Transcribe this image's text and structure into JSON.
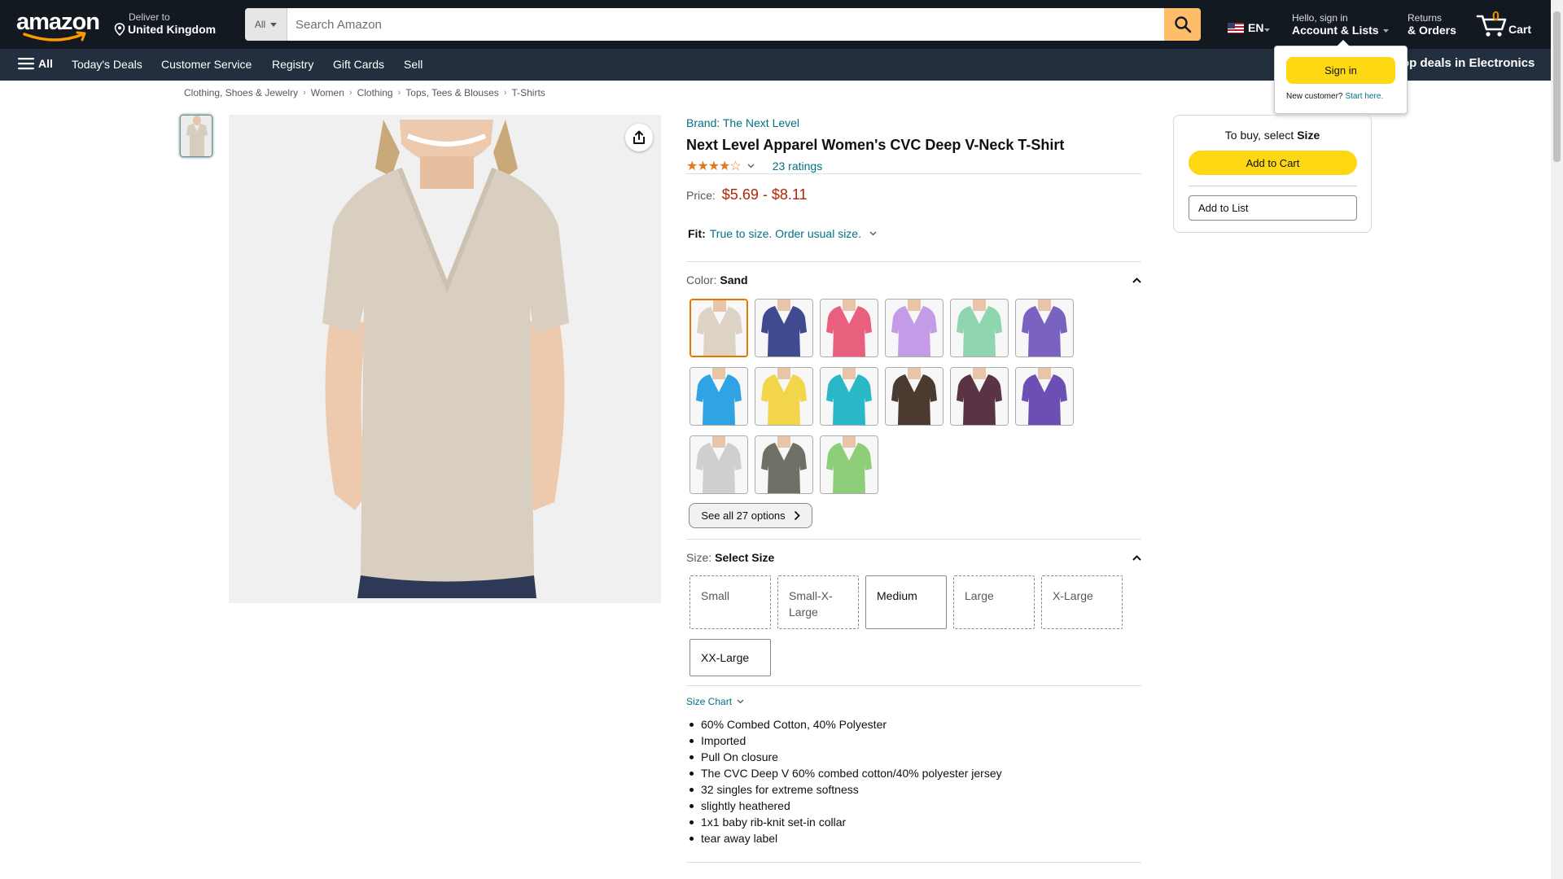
{
  "header": {
    "logo_text": "amazon",
    "deliver_line1": "Deliver to",
    "deliver_line2": "United Kingdom",
    "search_category": "All",
    "search_placeholder": "Search Amazon",
    "language": "EN",
    "account_line1": "Hello, sign in",
    "account_line2": "Account & Lists",
    "returns_line1": "Returns",
    "returns_line2": "& Orders",
    "cart_count": "0",
    "cart_label": "Cart"
  },
  "subnav": {
    "all_label": "All",
    "items": [
      "Today's Deals",
      "Customer Service",
      "Registry",
      "Gift Cards",
      "Sell"
    ],
    "promo": "op deals in Electronics"
  },
  "flyout": {
    "sign_in": "Sign in",
    "new_customer": "New customer?",
    "start_here": "Start here."
  },
  "breadcrumb": [
    "Clothing, Shoes & Jewelry",
    "Women",
    "Clothing",
    "Tops, Tees & Blouses",
    "T-Shirts"
  ],
  "product": {
    "brand": "Brand: The Next Level",
    "title": "Next Level Apparel Women's CVC Deep V-Neck T-Shirt",
    "stars": "★★★★☆",
    "rating_fraction": 0.86,
    "ratings": "23 ratings",
    "price_label": "Price:",
    "price": "$5.69 - $8.11",
    "fit_label": "Fit:",
    "fit_value": "True to size. Order usual size.",
    "color_label": "Color:",
    "color_value": "Sand",
    "colors": [
      "#ddd3c5",
      "#3f4a8f",
      "#e8607e",
      "#c39be6",
      "#8fd6b0",
      "#7a62c0",
      "#2fa3e3",
      "#f2d54a",
      "#2bb8c6",
      "#4a3a30",
      "#5a3345",
      "#6b4fb5",
      "#cfcfcf",
      "#6f6f66",
      "#8fce78"
    ],
    "see_all": "See all 27 options",
    "size_label": "Size:",
    "size_value": "Select Size",
    "sizes": [
      "Small",
      "Small-X-Large",
      "Medium",
      "Large",
      "X-Large",
      "XX-Large"
    ],
    "size_chart": "Size Chart",
    "bullets": [
      "60% Combed Cotton, 40% Polyester",
      "Imported",
      "Pull On closure",
      "The CVC Deep V 60% combed cotton/40% polyester jersey",
      "32 singles for extreme softness",
      "slightly heathered",
      "1x1 baby rib-knit set-in collar",
      "tear away label"
    ]
  },
  "buybox": {
    "title_prefix": "To buy, select",
    "title_bold": "Size",
    "add_to_cart": "Add to Cart",
    "add_to_list": "Add to List"
  },
  "colors": {
    "nav_bg": "#131921",
    "subnav_bg": "#232f3e",
    "search_button": "#febd69",
    "cta_yellow": "#ffd814",
    "link": "#007185",
    "price": "#b12704",
    "selected_swatch": "#e77600"
  }
}
